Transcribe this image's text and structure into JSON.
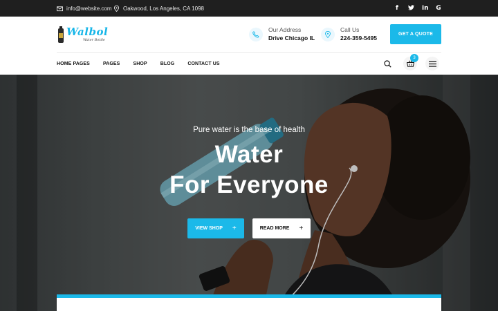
{
  "topbar": {
    "email": "info@website.com",
    "address": "Oakwood, Los Angeles, CA 1098",
    "socials": [
      "facebook-icon",
      "twitter-icon",
      "linkedin-icon",
      "google-icon"
    ]
  },
  "header": {
    "logo_text": "Walbol",
    "logo_tagline": "Water Bottle",
    "address_label": "Our Address",
    "address_value": "Drive Chicago IL",
    "call_label": "Call Us",
    "call_value": "224-359-5495",
    "quote_button": "GET A QUOTE"
  },
  "nav": {
    "items": [
      "HOME PAGES",
      "PAGES",
      "SHOP",
      "BLOG",
      "CONTACT US"
    ],
    "cart_count": "3"
  },
  "hero": {
    "subtitle": "Pure water is the base of health",
    "title_line1": "Water",
    "title_line2": "For Everyone",
    "primary_button": "VIEW SHOP",
    "secondary_button": "READ MORE"
  },
  "colors": {
    "accent": "#1bb9e9",
    "topbar_bg": "#1f1f1f",
    "text_dark": "#111111"
  }
}
